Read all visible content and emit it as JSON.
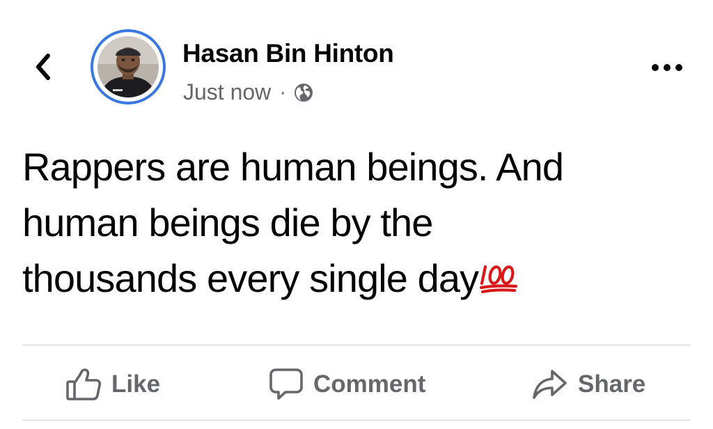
{
  "post": {
    "author_name": "Hasan Bin Hinton",
    "timestamp": "Just now",
    "separator": "·",
    "privacy_icon": "globe-icon",
    "text_lines": [
      "Rappers are human beings. And",
      "human beings die by the",
      "thousands every single day"
    ],
    "trailing_emoji": "hundred-points-icon"
  },
  "header": {
    "back_icon": "chevron-left-icon",
    "more_icon": "more-horizontal-icon"
  },
  "actions": {
    "like_label": "Like",
    "comment_label": "Comment",
    "share_label": "Share"
  },
  "colors": {
    "avatar_ring": "#3a78e0",
    "secondary_text": "#65676b",
    "primary_text": "#050505",
    "divider": "#ced0d4",
    "emoji_red": "#d7191c"
  }
}
